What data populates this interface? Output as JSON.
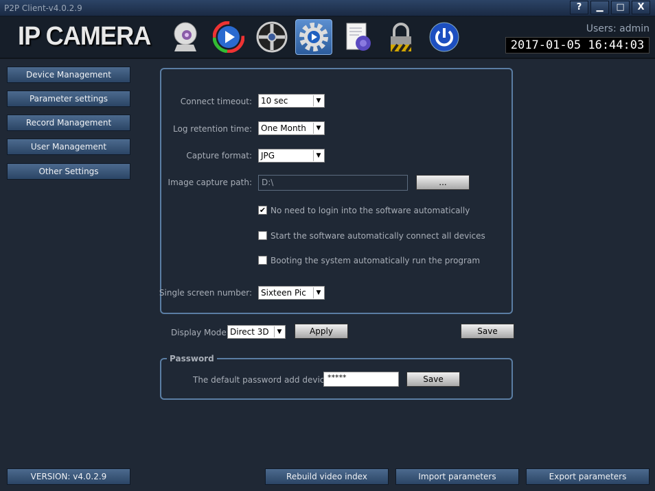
{
  "window": {
    "title": "P2P Client-v4.0.2.9",
    "help": "?",
    "minimize": "▁",
    "maximize": "□",
    "close": "X"
  },
  "header": {
    "logo": "IP CAMERA",
    "users": "Users: admin",
    "datetime": "2017-01-05 16:44:03",
    "toolbar": [
      {
        "icon": "webcam-icon"
      },
      {
        "icon": "play-icon"
      },
      {
        "icon": "film-reel-icon"
      },
      {
        "icon": "settings-gear-icon",
        "active": true
      },
      {
        "icon": "log-document-icon"
      },
      {
        "icon": "lock-icon"
      },
      {
        "icon": "power-icon"
      }
    ]
  },
  "sidebar": {
    "items": [
      {
        "label": "Device Management"
      },
      {
        "label": "Parameter settings"
      },
      {
        "label": "Record Management"
      },
      {
        "label": "User Management"
      },
      {
        "label": "Other Settings"
      }
    ],
    "version": "VERSION: v4.0.2.9"
  },
  "settings": {
    "connect_timeout": {
      "label": "Connect timeout:",
      "value": "10 sec"
    },
    "log_retention": {
      "label": "Log retention time:",
      "value": "One Month"
    },
    "capture_format": {
      "label": "Capture format:",
      "value": "JPG"
    },
    "capture_path": {
      "label": "Image capture path:",
      "value": "D:\\",
      "browse": "..."
    },
    "checkboxes": [
      {
        "label": "No need to login into the software automatically",
        "checked": true
      },
      {
        "label": "Start the software automatically connect all devices",
        "checked": false
      },
      {
        "label": "Booting the system automatically run the program",
        "checked": false
      }
    ],
    "single_screen": {
      "label": "Single screen number:",
      "value": "Sixteen Pic"
    }
  },
  "display": {
    "label": "Display Mode:",
    "value": "Direct 3D",
    "apply": "Apply",
    "save": "Save"
  },
  "password": {
    "legend": "Password",
    "label": "The default password add device",
    "value": "*****",
    "save": "Save"
  },
  "footer": {
    "rebuild": "Rebuild video index",
    "import": "Import parameters",
    "export": "Export parameters"
  }
}
